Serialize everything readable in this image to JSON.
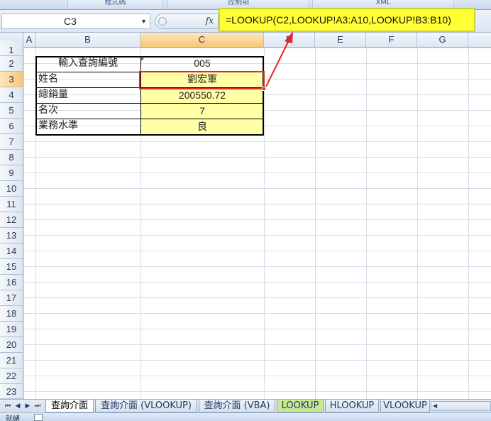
{
  "ribbon": {
    "groups": [
      "程式碼",
      "控制項",
      "XML"
    ]
  },
  "formula_bar": {
    "name_box": "C3",
    "fx_label": "fx",
    "formula": "=LOOKUP(C2,LOOKUP!A3:A10,LOOKUP!B3:B10)"
  },
  "columns": [
    "A",
    "B",
    "C",
    "D",
    "E",
    "F",
    "G"
  ],
  "rows": [
    "1",
    "2",
    "3",
    "4",
    "5",
    "6",
    "7",
    "8",
    "9",
    "10",
    "11",
    "12",
    "13",
    "14",
    "15",
    "16",
    "17",
    "18",
    "19",
    "20",
    "21",
    "22",
    "23"
  ],
  "table": {
    "header_label": "輸入查詢編號",
    "header_value": "005",
    "records": [
      {
        "label": "姓名",
        "value": "劉宏軍"
      },
      {
        "label": "總銷量",
        "value": "200550.72"
      },
      {
        "label": "名次",
        "value": "7"
      },
      {
        "label": "業務水準",
        "value": "良"
      }
    ]
  },
  "sheet_tabs": [
    "查詢介面",
    "查詢介面 (VLOOKUP)",
    "查詢介面 (VBA)",
    "LOOKUP",
    "HLOOKUP",
    "VLOOKUP"
  ],
  "nav_buttons": [
    "⏮",
    "◀",
    "▶",
    "⏭"
  ],
  "status": {
    "text": "就緒"
  },
  "colors": {
    "highlight": "#ffff33",
    "selection": "#e0282c",
    "fill": "#ffffa6"
  }
}
